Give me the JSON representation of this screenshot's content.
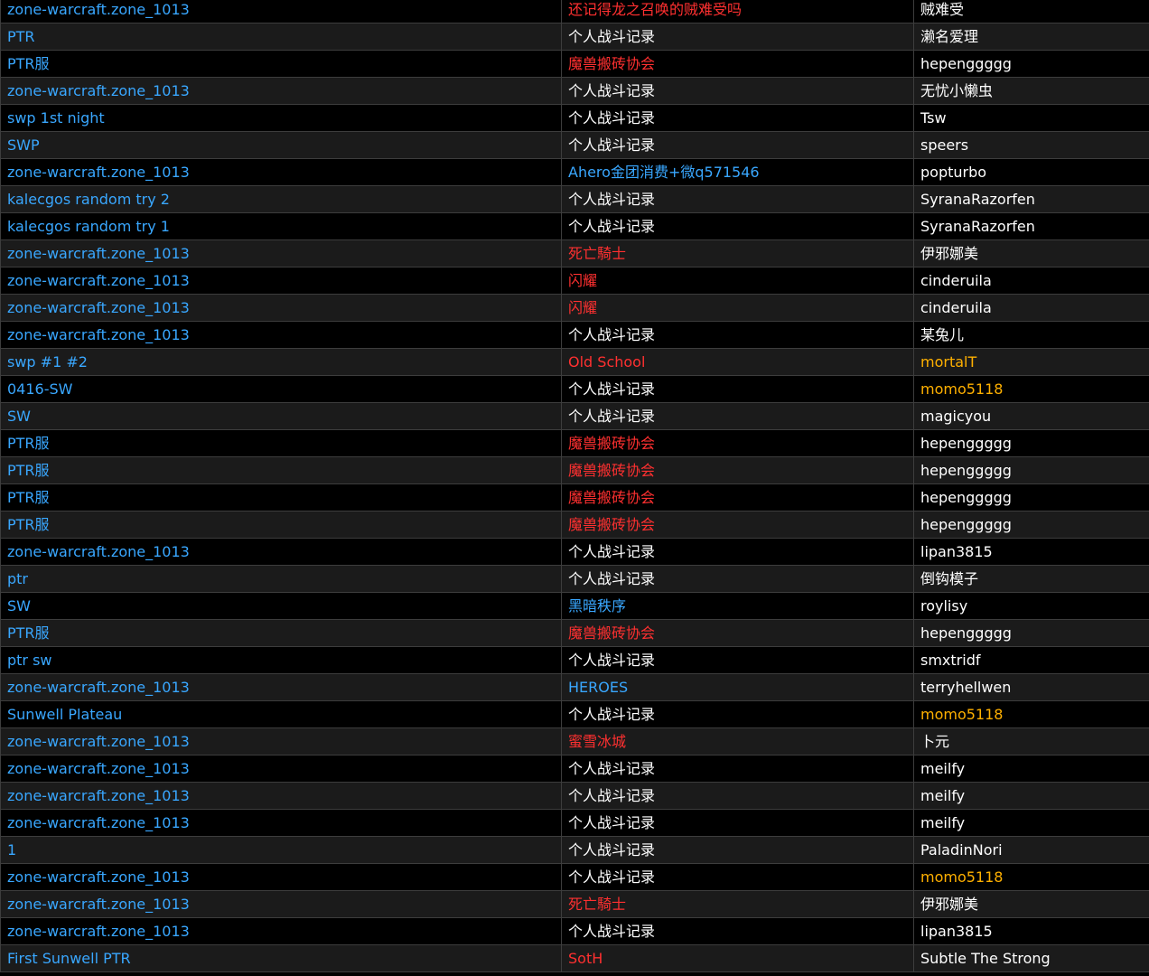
{
  "colors": {
    "link": "#39a7ff",
    "guild_red": "#ff3030",
    "guild_blue": "#39a7ff",
    "text": "#ffffff",
    "owner_gold": "#ffb000",
    "row_dark": "#000000",
    "row_alt": "#1b1b1b"
  },
  "rows": [
    {
      "name": "zone-warcraft.zone_1013",
      "guild": "还记得龙之召唤的贼难受吗",
      "guild_style": "red",
      "owner": "贼难受",
      "owner_style": "white"
    },
    {
      "name": "PTR",
      "guild": "个人战斗记录",
      "guild_style": "white",
      "owner": "濑名爱理",
      "owner_style": "white"
    },
    {
      "name": "PTR服",
      "guild": "魔兽搬砖协会",
      "guild_style": "red",
      "owner": "hepenggggg",
      "owner_style": "white"
    },
    {
      "name": "zone-warcraft.zone_1013",
      "guild": "个人战斗记录",
      "guild_style": "white",
      "owner": "无忧小懒虫",
      "owner_style": "white"
    },
    {
      "name": "swp 1st night",
      "guild": "个人战斗记录",
      "guild_style": "white",
      "owner": "Tsw",
      "owner_style": "white"
    },
    {
      "name": "SWP",
      "guild": "个人战斗记录",
      "guild_style": "white",
      "owner": "speers",
      "owner_style": "white"
    },
    {
      "name": "zone-warcraft.zone_1013",
      "guild": "Ahero金团消费+微q571546",
      "guild_style": "blue",
      "owner": "popturbo",
      "owner_style": "white"
    },
    {
      "name": "kalecgos random try 2",
      "guild": "个人战斗记录",
      "guild_style": "white",
      "owner": "SyranaRazorfen",
      "owner_style": "white"
    },
    {
      "name": "kalecgos random try 1",
      "guild": "个人战斗记录",
      "guild_style": "white",
      "owner": "SyranaRazorfen",
      "owner_style": "white"
    },
    {
      "name": "zone-warcraft.zone_1013",
      "guild": "死亡騎士",
      "guild_style": "red",
      "owner": "伊邪娜美",
      "owner_style": "white"
    },
    {
      "name": "zone-warcraft.zone_1013",
      "guild": "闪耀",
      "guild_style": "red",
      "owner": "cinderuila",
      "owner_style": "white"
    },
    {
      "name": "zone-warcraft.zone_1013",
      "guild": "闪耀",
      "guild_style": "red",
      "owner": "cinderuila",
      "owner_style": "white"
    },
    {
      "name": "zone-warcraft.zone_1013",
      "guild": "个人战斗记录",
      "guild_style": "white",
      "owner": "某兔儿",
      "owner_style": "white"
    },
    {
      "name": "swp #1 #2",
      "guild": "Old School",
      "guild_style": "red",
      "owner": "mortalT",
      "owner_style": "gold"
    },
    {
      "name": "0416-SW",
      "guild": "个人战斗记录",
      "guild_style": "white",
      "owner": "momo5118",
      "owner_style": "gold"
    },
    {
      "name": "SW",
      "guild": "个人战斗记录",
      "guild_style": "white",
      "owner": "magicyou",
      "owner_style": "white"
    },
    {
      "name": "PTR服",
      "guild": "魔兽搬砖协会",
      "guild_style": "red",
      "owner": "hepenggggg",
      "owner_style": "white"
    },
    {
      "name": "PTR服",
      "guild": "魔兽搬砖协会",
      "guild_style": "red",
      "owner": "hepenggggg",
      "owner_style": "white"
    },
    {
      "name": "PTR服",
      "guild": "魔兽搬砖协会",
      "guild_style": "red",
      "owner": "hepenggggg",
      "owner_style": "white"
    },
    {
      "name": "PTR服",
      "guild": "魔兽搬砖协会",
      "guild_style": "red",
      "owner": "hepenggggg",
      "owner_style": "white"
    },
    {
      "name": "zone-warcraft.zone_1013",
      "guild": "个人战斗记录",
      "guild_style": "white",
      "owner": "lipan3815",
      "owner_style": "white"
    },
    {
      "name": "ptr",
      "guild": "个人战斗记录",
      "guild_style": "white",
      "owner": "倒钩模子",
      "owner_style": "white"
    },
    {
      "name": "SW",
      "guild": "黑暗秩序",
      "guild_style": "blue",
      "owner": "roylisy",
      "owner_style": "white"
    },
    {
      "name": "PTR服",
      "guild": "魔兽搬砖协会",
      "guild_style": "red",
      "owner": "hepenggggg",
      "owner_style": "white"
    },
    {
      "name": "ptr sw",
      "guild": "个人战斗记录",
      "guild_style": "white",
      "owner": "smxtridf",
      "owner_style": "white"
    },
    {
      "name": "zone-warcraft.zone_1013",
      "guild": "HEROES",
      "guild_style": "blue",
      "owner": "terryhellwen",
      "owner_style": "white"
    },
    {
      "name": "Sunwell Plateau",
      "guild": "个人战斗记录",
      "guild_style": "white",
      "owner": "momo5118",
      "owner_style": "gold"
    },
    {
      "name": "zone-warcraft.zone_1013",
      "guild": "蜜雪冰城",
      "guild_style": "red",
      "owner": "卜元",
      "owner_style": "white"
    },
    {
      "name": "zone-warcraft.zone_1013",
      "guild": "个人战斗记录",
      "guild_style": "white",
      "owner": "meilfy",
      "owner_style": "white"
    },
    {
      "name": "zone-warcraft.zone_1013",
      "guild": "个人战斗记录",
      "guild_style": "white",
      "owner": "meilfy",
      "owner_style": "white"
    },
    {
      "name": "zone-warcraft.zone_1013",
      "guild": "个人战斗记录",
      "guild_style": "white",
      "owner": "meilfy",
      "owner_style": "white"
    },
    {
      "name": "1",
      "guild": "个人战斗记录",
      "guild_style": "white",
      "owner": "PaladinNori",
      "owner_style": "white"
    },
    {
      "name": "zone-warcraft.zone_1013",
      "guild": "个人战斗记录",
      "guild_style": "white",
      "owner": "momo5118",
      "owner_style": "gold"
    },
    {
      "name": "zone-warcraft.zone_1013",
      "guild": "死亡騎士",
      "guild_style": "red",
      "owner": "伊邪娜美",
      "owner_style": "white"
    },
    {
      "name": "zone-warcraft.zone_1013",
      "guild": "个人战斗记录",
      "guild_style": "white",
      "owner": "lipan3815",
      "owner_style": "white"
    },
    {
      "name": "First Sunwell PTR",
      "guild": "SotH",
      "guild_style": "red",
      "owner": "Subtle The Strong",
      "owner_style": "white"
    }
  ]
}
